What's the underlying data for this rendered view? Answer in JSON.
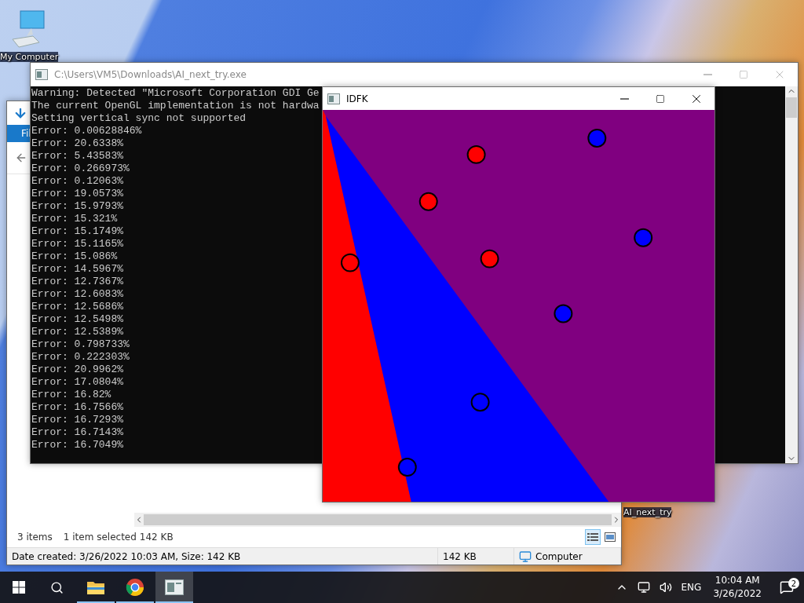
{
  "desktop": {
    "icons": [
      {
        "label": "My Computer",
        "kind": "computer"
      },
      {
        "label": "AI_next_try",
        "kind": "file"
      }
    ]
  },
  "explorer": {
    "ribbon_tab": "Fil",
    "item_count": "3 items",
    "selection": "1 item selected",
    "selection_size": "142 KB",
    "details": "Date created: 3/26/2022 10:03 AM, Size: 142 KB",
    "details_size": "142 KB",
    "location": "Computer"
  },
  "console": {
    "title": "C:\\Users\\VM5\\Downloads\\AI_next_try.exe",
    "lines": [
      "Warning: Detected \"Microsoft Corporation GDI Ge",
      "The current OpenGL implementation is not hardwa",
      "Setting vertical sync not supported",
      "Error: 0.00628846%",
      "Error: 20.6338%",
      "Error: 5.43583%",
      "Error: 0.266973%",
      "Error: 0.12063%",
      "Error: 19.0573%",
      "Error: 15.9793%",
      "Error: 15.321%",
      "Error: 15.1749%",
      "Error: 15.1165%",
      "Error: 15.086%",
      "Error: 14.5967%",
      "Error: 12.7367%",
      "Error: 12.6083%",
      "Error: 12.5686%",
      "Error: 12.5498%",
      "Error: 12.5389%",
      "Error: 0.798733%",
      "Error: 0.222303%",
      "Error: 20.9962%",
      "Error: 17.0804%",
      "Error: 16.82%",
      "Error: 16.7566%",
      "Error: 16.7293%",
      "Error: 16.7143%",
      "Error: 16.7049%"
    ]
  },
  "graph_window": {
    "title": "IDFK"
  },
  "taskbar": {
    "apps": [
      {
        "kind": "explorer",
        "selected": false
      },
      {
        "kind": "chrome",
        "selected": false
      },
      {
        "kind": "console",
        "selected": true
      }
    ],
    "language": "ENG",
    "time": "10:04 AM",
    "date": "3/26/2022",
    "notifications": "2"
  }
}
